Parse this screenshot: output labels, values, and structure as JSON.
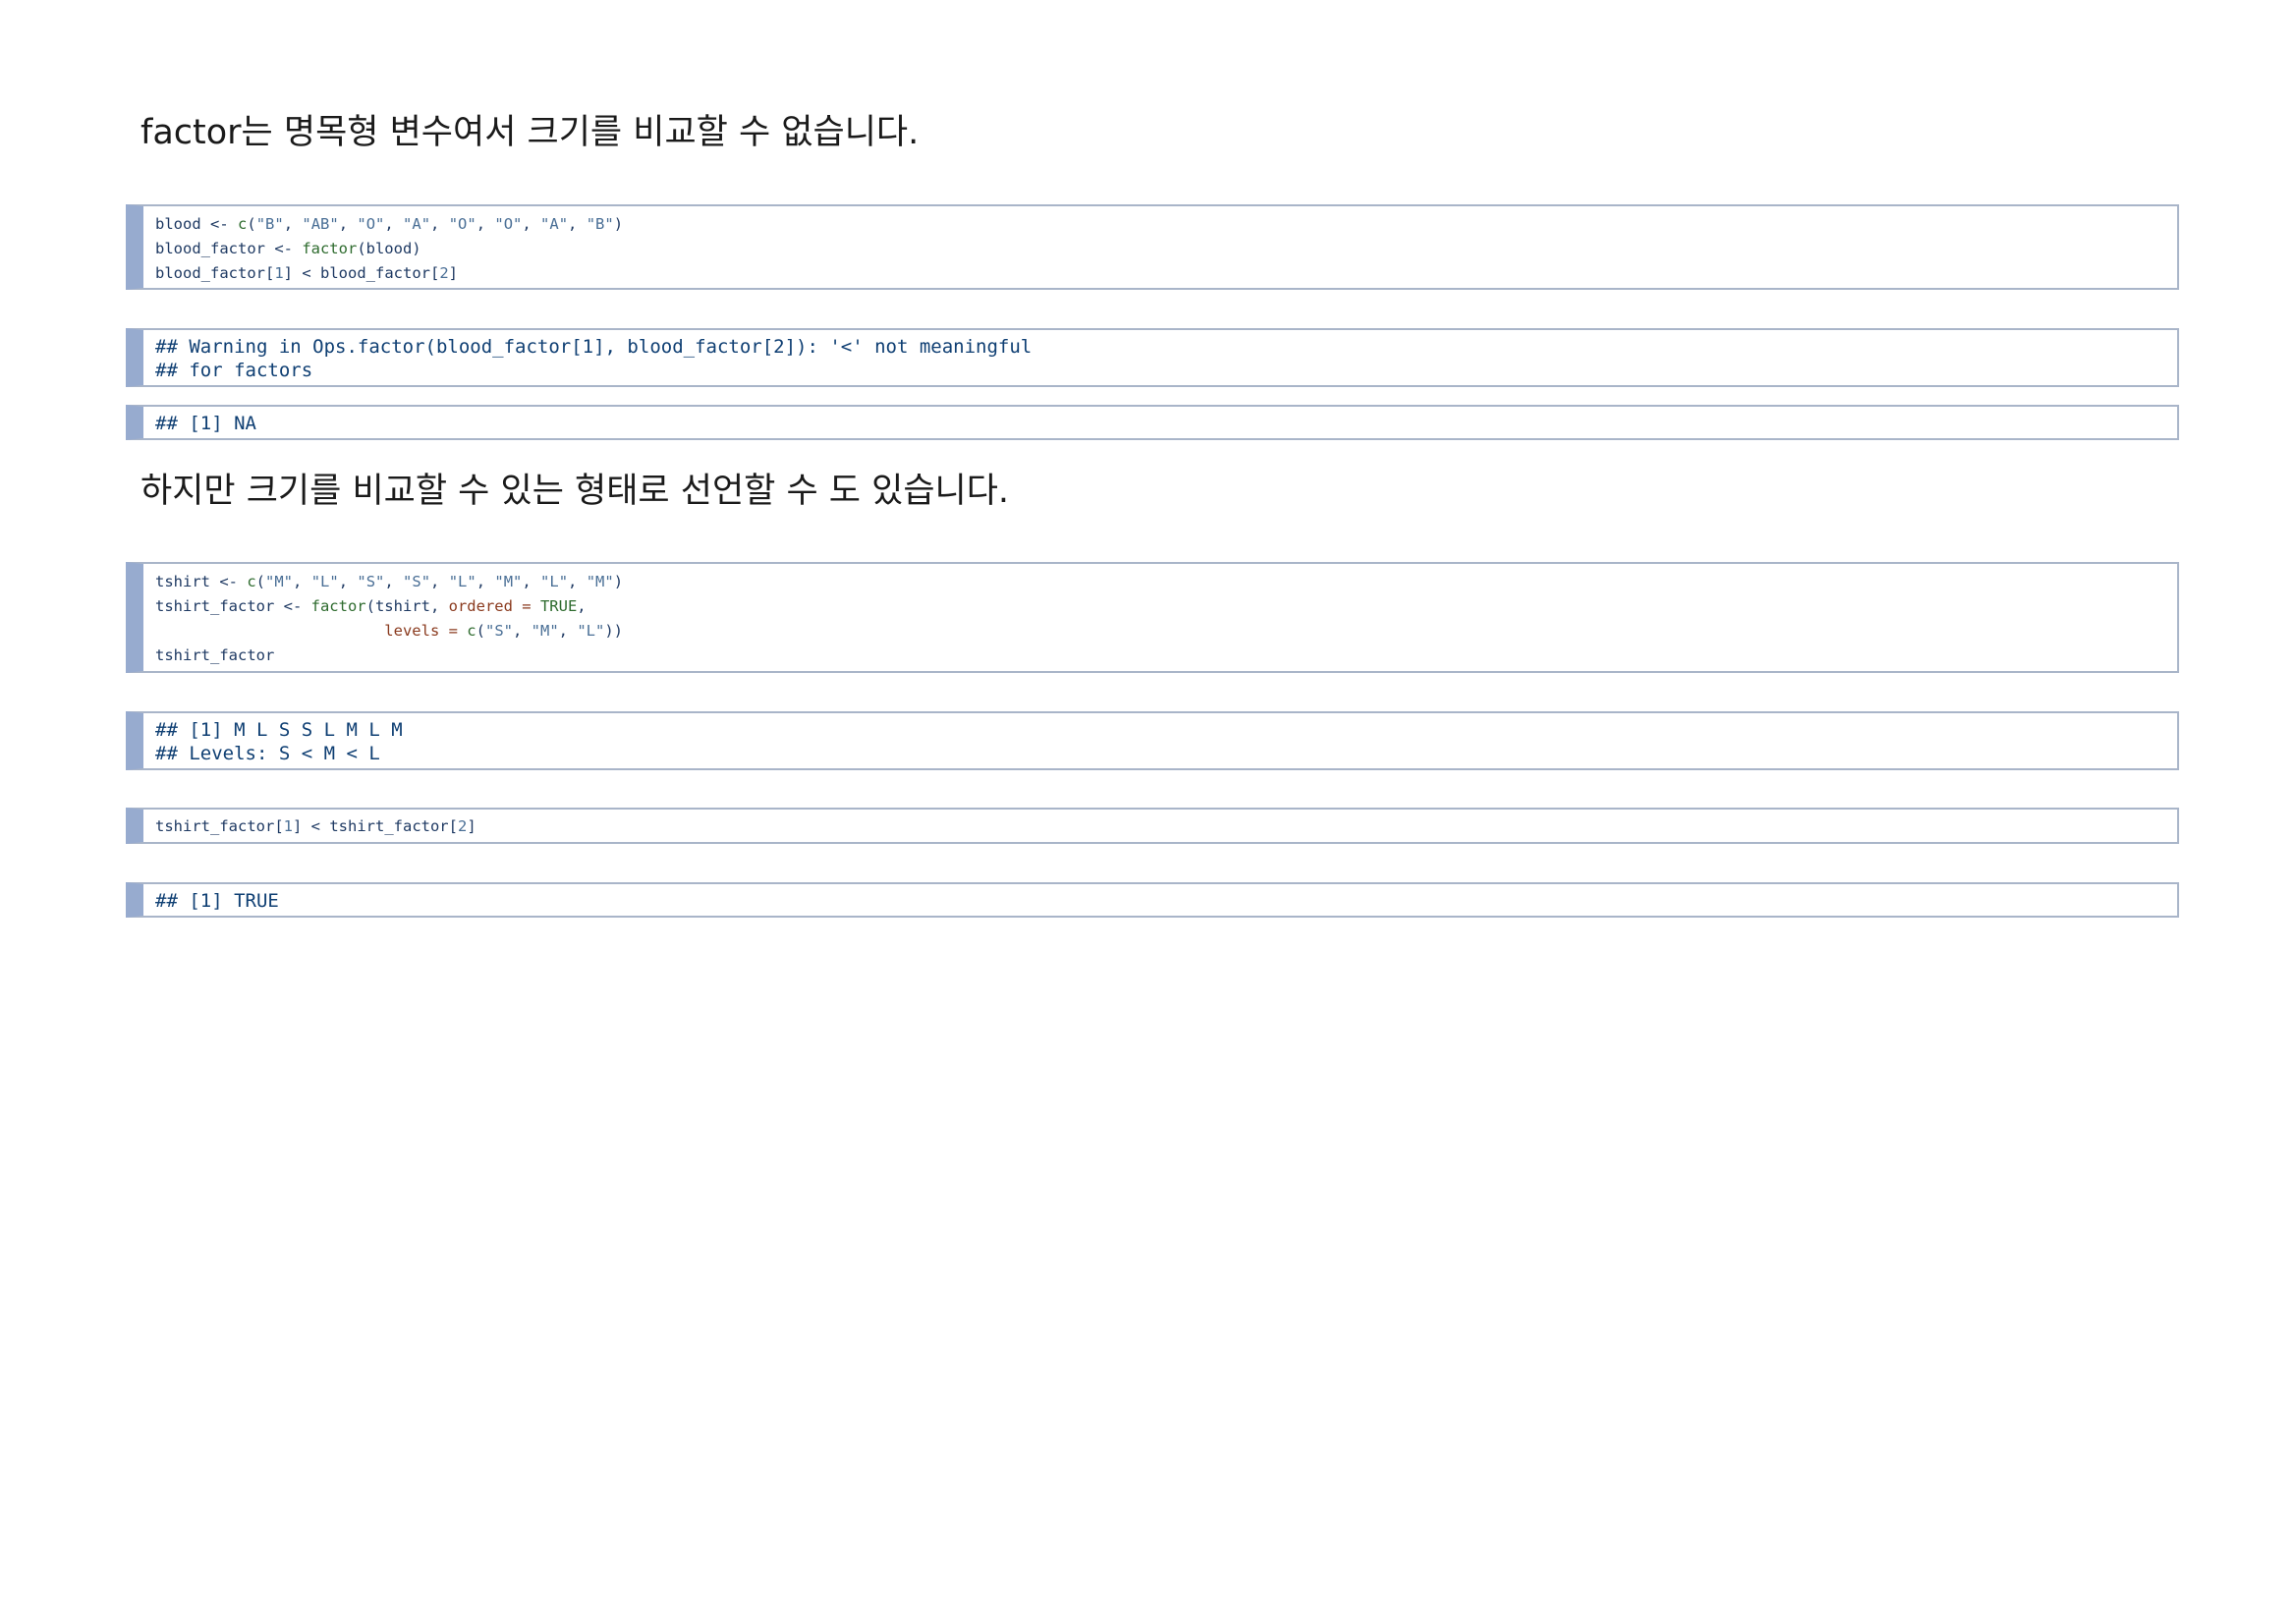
{
  "paragraphs": {
    "p1": "factor는 명목형 변수여서 크기를 비교할 수 없습니다.",
    "p2": "하지만 크기를 비교할 수 있는 형태로 선언할 수 도 있습니다."
  },
  "code1": {
    "l1": [
      "blood <- ",
      "c",
      "(",
      "\"B\"",
      ", ",
      "\"AB\"",
      ", ",
      "\"O\"",
      ", ",
      "\"A\"",
      ", ",
      "\"O\"",
      ", ",
      "\"O\"",
      ", ",
      "\"A\"",
      ", ",
      "\"B\"",
      ")"
    ],
    "l2": [
      "blood_factor <- ",
      "factor",
      "(blood)"
    ],
    "l3": [
      "blood_factor[",
      "1",
      "] < blood_factor[",
      "2",
      "]"
    ]
  },
  "output1": {
    "l1": "## Warning in Ops.factor(blood_factor[1], blood_factor[2]): '<' not meaningful",
    "l2": "## for factors"
  },
  "output2": {
    "l1": "## [1] NA"
  },
  "code2": {
    "l1": [
      "tshirt <- ",
      "c",
      "(",
      "\"M\"",
      ", ",
      "\"L\"",
      ", ",
      "\"S\"",
      ", ",
      "\"S\"",
      ", ",
      "\"L\"",
      ", ",
      "\"M\"",
      ", ",
      "\"L\"",
      ", ",
      "\"M\"",
      ")"
    ],
    "l2": [
      "tshirt_factor <- ",
      "factor",
      "(tshirt, ",
      "ordered",
      " = ",
      "TRUE",
      ","
    ],
    "l3": [
      "                         ",
      "levels",
      " = ",
      "c",
      "(",
      "\"S\"",
      ", ",
      "\"M\"",
      ", ",
      "\"L\"",
      "))"
    ],
    "l4": [
      "tshirt_factor"
    ]
  },
  "output3": {
    "l1": "## [1] M L S S L M L M",
    "l2": "## Levels: S < M < L"
  },
  "code3": {
    "l1": [
      "tshirt_factor[",
      "1",
      "] < tshirt_factor[",
      "2",
      "]"
    ]
  },
  "output4": {
    "l1": "## [1] TRUE"
  }
}
